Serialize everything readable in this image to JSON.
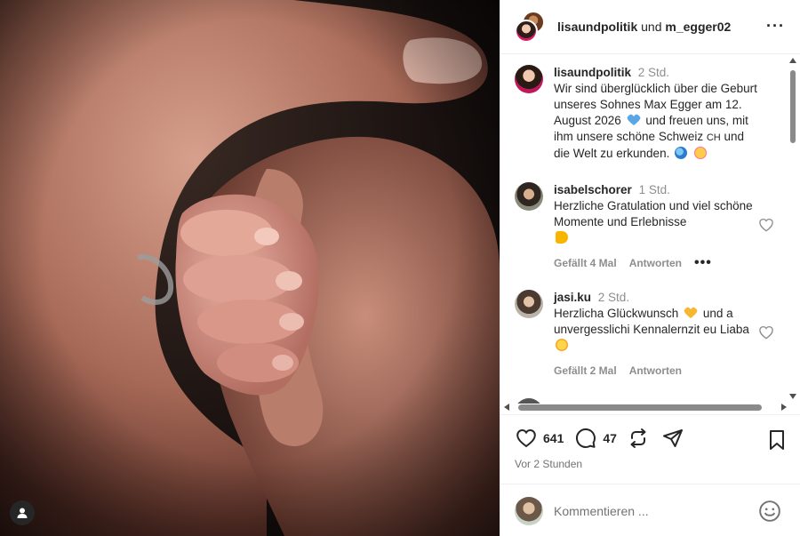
{
  "header": {
    "user1": "lisaundpolitik",
    "connector": "und",
    "user2": "m_egger02",
    "more_icon": "more-horizontal-icon"
  },
  "caption": {
    "username": "lisaundpolitik",
    "time": "2 Std.",
    "text_1": "Wir sind überglücklich über die Geburt unseres Sohnes Max Egger am 12. August 2026",
    "text_2": "und freuen uns, mit ihm unsere schöne Schweiz",
    "flag_text": "CH",
    "text_3": "und die Welt zu erkunden."
  },
  "comments": [
    {
      "username": "isabelschorer",
      "time": "1 Std.",
      "text": "Herzliche Gratulation und viel schöne Momente und Erlebnisse",
      "likes": "Gefällt 4 Mal",
      "reply": "Antworten",
      "more": "•••"
    },
    {
      "username": "jasi.ku",
      "time": "2 Std.",
      "text_1": "Herzlicha Glückwunsch",
      "text_2": "und a unvergesslichi Kennalernzit eu Liaba",
      "likes": "Gefällt 2 Mal",
      "reply": "Antworten"
    }
  ],
  "actions": {
    "likes_count": "641",
    "comments_count": "47",
    "posted": "Vor 2 Stunden"
  },
  "composer": {
    "placeholder": "Kommentieren ..."
  },
  "colors": {
    "text": "#262626",
    "muted": "#8e8e8e",
    "heart_blue": "#5aa6e6",
    "heart_yellow": "#f7b733"
  }
}
